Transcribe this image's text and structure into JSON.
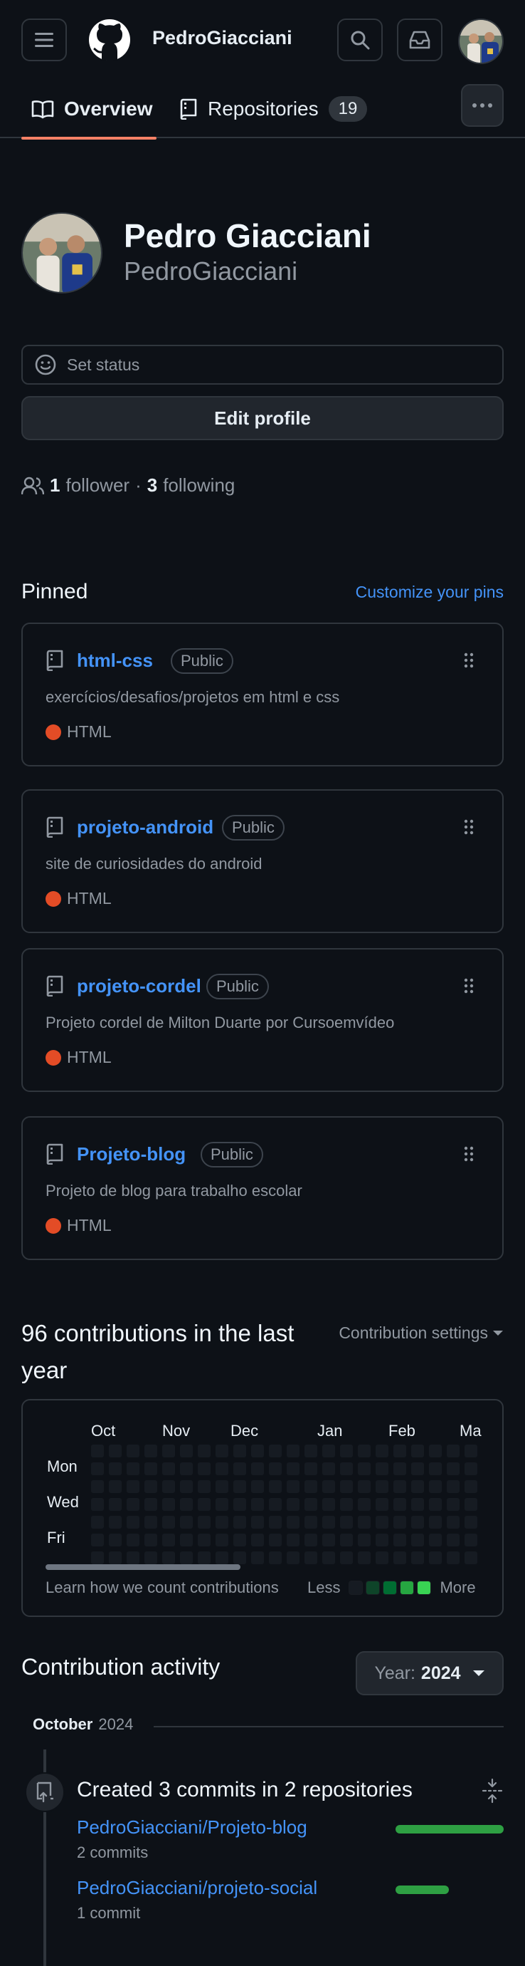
{
  "header": {
    "username": "PedroGiacciani",
    "icons": [
      "menu-icon",
      "github-logo-icon",
      "search-icon",
      "inbox-icon"
    ]
  },
  "tabs": [
    {
      "label": "Overview"
    },
    {
      "label": "Repositories",
      "count": "19"
    }
  ],
  "profile": {
    "name": "Pedro Giacciani",
    "login": "PedroGiacciani",
    "status_placeholder": "Set status",
    "edit_label": "Edit profile",
    "followers_count": "1",
    "followers_label": "follower",
    "sep": "·",
    "following_count": "3",
    "following_label": "following"
  },
  "pinned": {
    "title": "Pinned",
    "customize": "Customize your pins",
    "items": [
      {
        "name": "html-css",
        "visibility": "Public",
        "description": "exercícios/desafios/projetos em html e css",
        "language": "HTML"
      },
      {
        "name": "projeto-android",
        "visibility": "Public",
        "description": "site de curiosidades do android",
        "language": "HTML"
      },
      {
        "name": "projeto-cordel",
        "visibility": "Public",
        "description": "Projeto cordel de Milton Duarte por Cursoemvídeo",
        "language": "HTML"
      },
      {
        "name": "Projeto-blog",
        "visibility": "Public",
        "description": "Projeto de blog para trabalho escolar",
        "language": "HTML"
      }
    ],
    "language_color": "#e34c26"
  },
  "contributions": {
    "title_line1": "96 contributions in the last",
    "title_line2": "year",
    "settings": "Contribution settings",
    "months": [
      "Oct",
      "Nov",
      "Dec",
      "Jan",
      "Feb",
      "Ma"
    ],
    "days": [
      "Mon",
      "Wed",
      "Fri"
    ],
    "learn": "Learn how we count contributions",
    "less": "Less",
    "more": "More",
    "legend_colors": [
      "#161b22",
      "#0e4429",
      "#006d32",
      "#26a641",
      "#39d353"
    ]
  },
  "activity": {
    "title": "Contribution activity",
    "year_prefix": "Year:",
    "year": "2024",
    "month": "October",
    "month_year": "2024",
    "event": "Created 3 commits in 2 repositories",
    "repos": [
      {
        "name": "PedroGiacciani/Projeto-blog",
        "commits": "2 commits",
        "share": 0.67
      },
      {
        "name": "PedroGiacciani/projeto-social",
        "commits": "1 commit",
        "share": 0.33
      }
    ],
    "bar_color": "#2ea043"
  }
}
